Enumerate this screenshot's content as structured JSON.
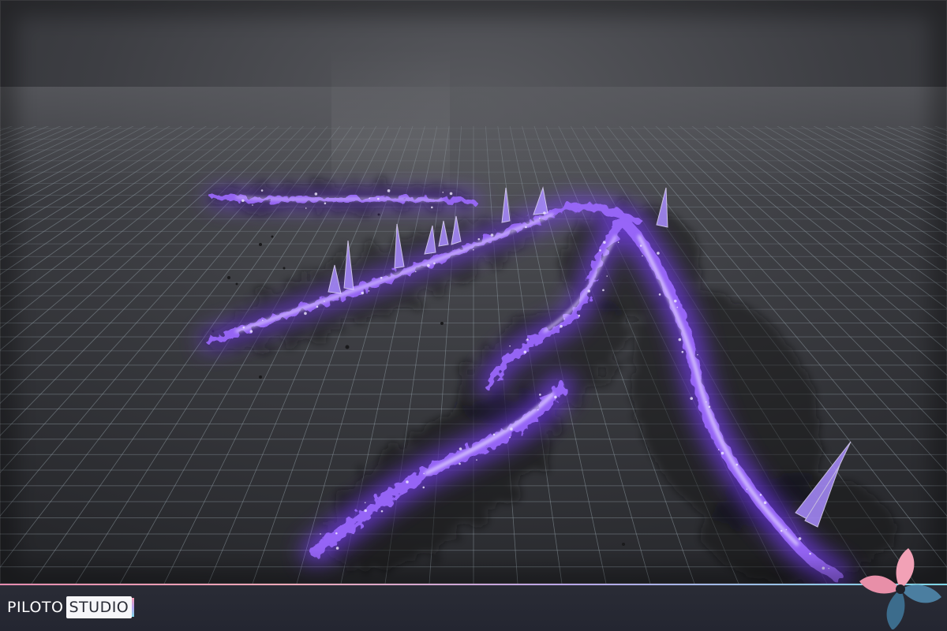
{
  "brand": {
    "wordmark_part1": "PILOTO",
    "wordmark_part2": "STUDIO"
  },
  "colors": {
    "background": "#3a3b3f",
    "grid_line": "#8e9aa3",
    "energy_core": "#c9b3ff",
    "energy_glow": "#7a3cff",
    "scorch": "#151417",
    "bar_background": "#262833",
    "logo_pink": "#f2a1b6",
    "logo_blue": "#4b7ea0"
  },
  "icons": {
    "logo_mark": "pinwheel-icon"
  }
}
